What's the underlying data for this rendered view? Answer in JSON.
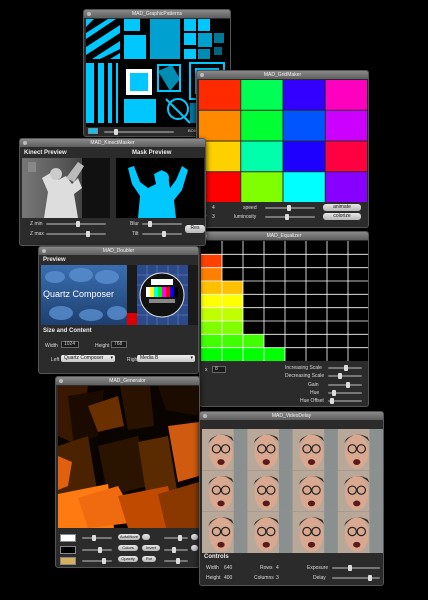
{
  "graphics_pattern": {
    "title": "MAD_GraphicPatterns",
    "footer": [
      "BOX",
      "FILL"
    ]
  },
  "grid_maker": {
    "title": "MAD_GridMaker",
    "x_label": "x",
    "x_value": "4",
    "y_label": "y",
    "y_value": "3",
    "speed_label": "speed",
    "luminosity_label": "luminosity",
    "animate_label": "animate",
    "colorize_label": "colorize",
    "cell_colors": [
      "#ff2a00",
      "#00ff55",
      "#3300ff",
      "#ff00bf",
      "#ff8a00",
      "#00ff33",
      "#0055ff",
      "#cc00ff",
      "#ffd000",
      "#00ffaa",
      "#1e00ff",
      "#ff0040",
      "#ff0000",
      "#80ff00",
      "#00ffff",
      "#8800ff"
    ]
  },
  "kinect_masker": {
    "title": "MAD_KinectMasker",
    "kinect_preview_label": "Kinect Preview",
    "mask_preview_label": "Mask Preview",
    "zmin_label": "Z min",
    "zmax_label": "Z max",
    "blur_label": "Blur",
    "tilt_label": "Tilt",
    "reset_label": "Res"
  },
  "doubler": {
    "title": "MAD_Doubler",
    "preview_label": "Preview",
    "qc_label": "Quartz Composer",
    "size_content_label": "Size and Content",
    "width_label": "Width",
    "width_value": "1024",
    "height_label": "Height",
    "height_value": "768",
    "left_label": "Left",
    "left_value": "Quartz Composer",
    "right_label": "Right",
    "right_value": "Media B"
  },
  "equalizer": {
    "title": "MAD_Equalizer",
    "x_label": "x",
    "x_value": "8",
    "increasing_label": "Increasing Scale",
    "decreasing_label": "Decreasing Scale",
    "gain_label": "Gain",
    "hue_label": "Hue",
    "hue_offset_label": "Hue Offset",
    "bar_heights": [
      0.92,
      0.72,
      0.25,
      0.08,
      0.0,
      0.0,
      0.0,
      0.0
    ]
  },
  "generator": {
    "title": "MAD_Generator",
    "buttons": [
      "AutoMove",
      "Colors",
      "Invert",
      "Opacity",
      "Rot"
    ]
  },
  "video_delay": {
    "title": "MAD_VideoDelay",
    "controls_label": "Controls",
    "width_label": "Width",
    "width_value": "640",
    "height_label": "Height",
    "height_value": "400",
    "rows_label": "Rows",
    "rows_value": "4",
    "columns_label": "Columns",
    "columns_value": "3",
    "exposure_label": "Exposure",
    "delay_label": "Delay"
  }
}
